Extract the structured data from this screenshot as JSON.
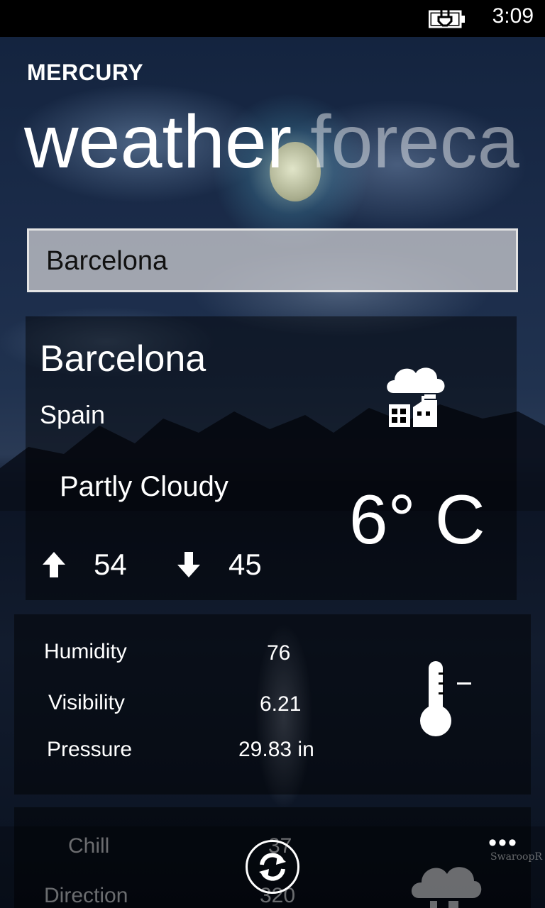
{
  "status_bar": {
    "time": "3:09",
    "battery_icon": "battery-charging-icon"
  },
  "app": {
    "name": "MERCURY"
  },
  "pivot": {
    "active": "weather",
    "next": "foreca"
  },
  "search": {
    "value": "Barcelona"
  },
  "location": {
    "city": "Barcelona",
    "country": "Spain"
  },
  "current": {
    "condition": "Partly Cloudy",
    "temperature": "6° C",
    "high": "54",
    "low": "45",
    "icon": "cloud-industry-icon"
  },
  "details": [
    {
      "label": "Humidity",
      "value": "76"
    },
    {
      "label": "Visibility",
      "value": "6.21"
    },
    {
      "label": "Pressure",
      "value": "29.83 in"
    }
  ],
  "wind": [
    {
      "label": "Chill",
      "value": "37"
    },
    {
      "label": "Direction",
      "value": "320"
    }
  ],
  "app_bar": {
    "more": "•••",
    "refresh_icon": "refresh-icon"
  },
  "watermark": "SwaroopR"
}
